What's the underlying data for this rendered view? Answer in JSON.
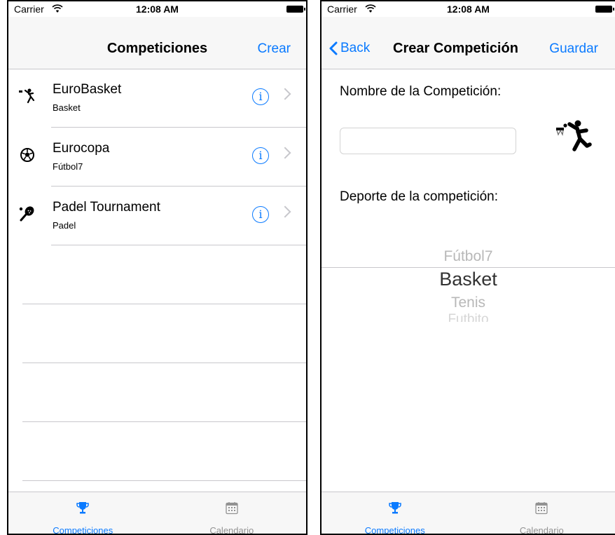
{
  "status": {
    "carrier": "Carrier",
    "time": "12:08 AM"
  },
  "left": {
    "nav": {
      "title": "Competiciones",
      "action": "Crear"
    },
    "items": [
      {
        "title": "EuroBasket",
        "subtitle": "Basket",
        "icon": "basketball-player-icon"
      },
      {
        "title": "Eurocopa",
        "subtitle": "Fútbol7",
        "icon": "soccer-ball-icon"
      },
      {
        "title": "Padel Tournament",
        "subtitle": "Padel",
        "icon": "padel-racket-icon"
      }
    ]
  },
  "right": {
    "nav": {
      "back": "Back",
      "title": "Crear Competición",
      "action": "Guardar"
    },
    "name_label": "Nombre de la Competición:",
    "name_input_value": "",
    "sport_label": "Deporte de la competición:",
    "picker_options": [
      "Fútbol7",
      "Basket",
      "Tenis",
      "Futbito"
    ],
    "picker_selected": "Basket"
  },
  "tabs": [
    {
      "label": "Competiciones",
      "icon": "trophy-icon",
      "active": true
    },
    {
      "label": "Calendario",
      "icon": "calendar-icon",
      "active": false
    }
  ],
  "colors": {
    "accent": "#0a7aff",
    "separator": "#c8c7cc",
    "inactive": "#929292"
  }
}
